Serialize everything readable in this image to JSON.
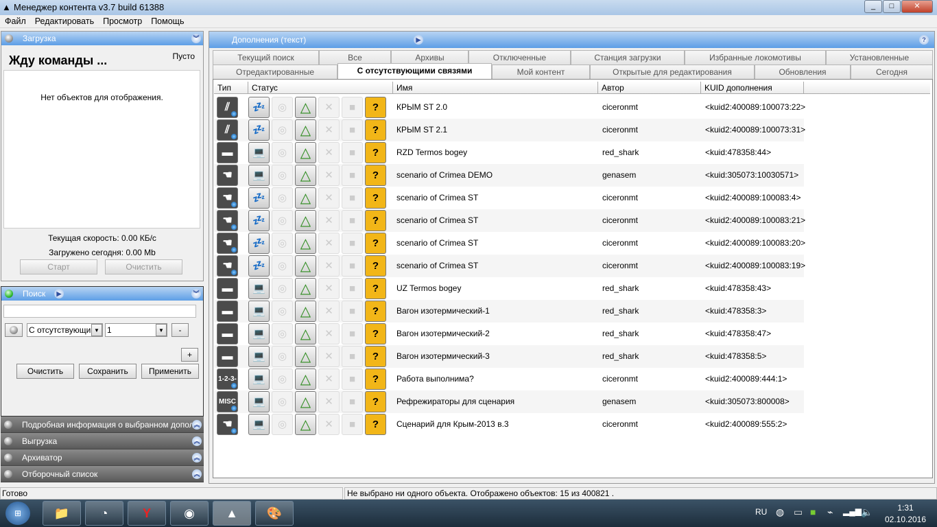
{
  "window": {
    "title": "Менеджер контента v3.7 build 61388",
    "min": "_",
    "max": "□",
    "close": "✕"
  },
  "menu": [
    "Файл",
    "Редактировать",
    "Просмотр",
    "Помощь"
  ],
  "download": {
    "header": "Загрузка",
    "status": "Жду команды ...",
    "empty_label": "Пусто",
    "no_objects": "Нет объектов для отображения.",
    "speed": "Текущая скорость: 0.00 КБ/с",
    "today": "Загружено сегодня: 0.00 Mb",
    "start": "Старт",
    "clear": "Очистить"
  },
  "search": {
    "header": "Поиск",
    "query": "",
    "filter_value": "С отсутствующими",
    "filter_number": "1",
    "minus": "-",
    "plus": "+",
    "clear": "Очистить",
    "save": "Сохранить",
    "apply": "Применить"
  },
  "collapsed_panels": [
    "Подробная информация о выбранном дополнении",
    "Выгрузка",
    "Архиватор",
    "Отборочный список"
  ],
  "statusbar": {
    "left": "Готово",
    "right": "Не выбрано ни одного объекта. Отображено объектов: 15 из 400821 ."
  },
  "content": {
    "header": "Дополнения (текст)",
    "help": "?",
    "tabs_row1": [
      "Текущий поиск",
      "Все",
      "Архивы",
      "Отключенные",
      "Станция загрузки",
      "Избранные локомотивы",
      "Установленные"
    ],
    "tabs_row2": [
      "Отредактированные",
      "С отсутствующими связями",
      "Мой контент",
      "Открытые для редактирования",
      "Обновления",
      "Сегодня"
    ],
    "active_tab": "С отсутствующими связями",
    "columns": [
      "Тип",
      "Статус",
      "Имя",
      "Автор",
      "KUID дополнения"
    ],
    "rows": [
      {
        "type": "track",
        "dot": true,
        "status": "zzz",
        "name": "КРЫМ ST 2.0",
        "author": "ciceronmt",
        "kuid": "<kuid2:400089:100073:22>"
      },
      {
        "type": "track",
        "dot": true,
        "status": "zzz",
        "name": "КРЫМ ST 2.1",
        "author": "ciceronmt",
        "kuid": "<kuid2:400089:100073:31>"
      },
      {
        "type": "truck",
        "dot": false,
        "status": "laptop",
        "name": "RZD Termos bogey",
        "author": "red_shark",
        "kuid": "<kuid:478358:44>"
      },
      {
        "type": "scenario",
        "dot": false,
        "status": "laptop",
        "name": "scenario of Crimea DEMO",
        "author": "genasem",
        "kuid": "<kuid:305073:10030571>"
      },
      {
        "type": "scenario",
        "dot": true,
        "status": "zzz",
        "name": "scenario of Crimea ST",
        "author": "ciceronmt",
        "kuid": "<kuid2:400089:100083:4>"
      },
      {
        "type": "scenario",
        "dot": true,
        "status": "zzz",
        "name": "scenario of Crimea ST",
        "author": "ciceronmt",
        "kuid": "<kuid2:400089:100083:21>"
      },
      {
        "type": "scenario",
        "dot": true,
        "status": "zzz",
        "name": "scenario of Crimea ST",
        "author": "ciceronmt",
        "kuid": "<kuid2:400089:100083:20>"
      },
      {
        "type": "scenario",
        "dot": true,
        "status": "zzz",
        "name": "scenario of Crimea ST",
        "author": "ciceronmt",
        "kuid": "<kuid2:400089:100083:19>"
      },
      {
        "type": "truck",
        "dot": false,
        "status": "laptop",
        "name": "UZ Termos bogey",
        "author": "red_shark",
        "kuid": "<kuid:478358:43>"
      },
      {
        "type": "truck",
        "dot": false,
        "status": "laptop",
        "name": "Вагон изотермический-1",
        "author": "red_shark",
        "kuid": "<kuid:478358:3>"
      },
      {
        "type": "truck",
        "dot": false,
        "status": "laptop",
        "name": "Вагон изотермический-2",
        "author": "red_shark",
        "kuid": "<kuid:478358:47>"
      },
      {
        "type": "truck",
        "dot": false,
        "status": "laptop",
        "name": "Вагон изотермический-3",
        "author": "red_shark",
        "kuid": "<kuid:478358:5>"
      },
      {
        "type": "1-2-3-4",
        "dot": true,
        "status": "laptop",
        "name": "Работа выполнима?",
        "author": "ciceronmt",
        "kuid": "<kuid2:400089:444:1>"
      },
      {
        "type": "MISC",
        "dot": true,
        "status": "laptop",
        "name": "Рефрежираторы для сценария",
        "author": "genasem",
        "kuid": "<kuid:305073:800008>"
      },
      {
        "type": "scenario",
        "dot": true,
        "status": "laptop",
        "name": "Сценарий для Крым-2013 в.3",
        "author": "ciceronmt",
        "kuid": "<kuid2:400089:555:2>"
      }
    ]
  },
  "taskbar": {
    "lang": "RU",
    "time": "1:31",
    "date": "02.10.2016"
  }
}
